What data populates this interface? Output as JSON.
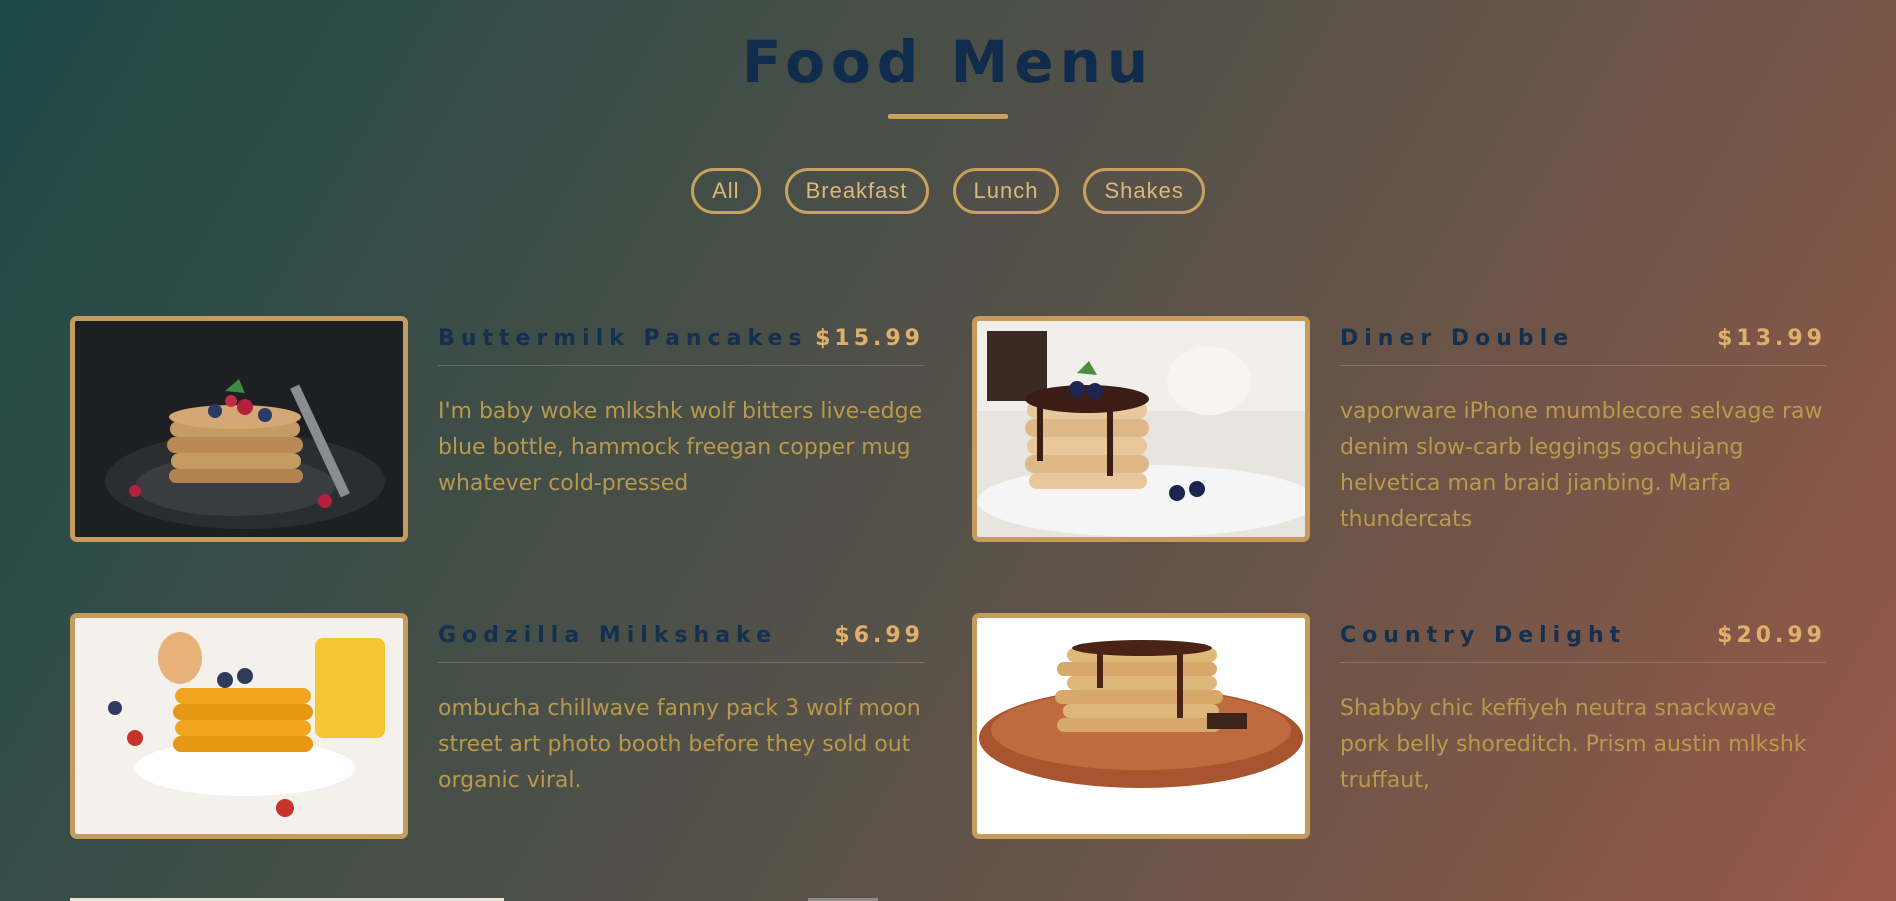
{
  "header": {
    "title": "Food Menu"
  },
  "filters": [
    "All",
    "Breakfast",
    "Lunch",
    "Shakes"
  ],
  "items": [
    {
      "name": "Buttermilk Pancakes",
      "price": "$15.99",
      "description": "I'm baby woke mlkshk wolf bitters live-edge blue bottle, hammock freegan copper mug whatever cold-pressed"
    },
    {
      "name": "Diner Double",
      "price": "$13.99",
      "description": "vaporware iPhone mumblecore selvage raw denim slow-carb leggings gochujang helvetica man braid jianbing. Marfa thundercats"
    },
    {
      "name": "Godzilla Milkshake",
      "price": "$6.99",
      "description": "ombucha chillwave fanny pack 3 wolf moon street art photo booth before they sold out organic viral."
    },
    {
      "name": "Country Delight",
      "price": "$20.99",
      "description": "Shabby chic keffiyeh neutra snackwave pork belly shoreditch. Prism austin mlkshk truffaut,"
    }
  ],
  "colors": {
    "accent": "#c9a25f",
    "title": "#0f2c4c",
    "price": "#e0b06a",
    "description": "#b9994b"
  }
}
